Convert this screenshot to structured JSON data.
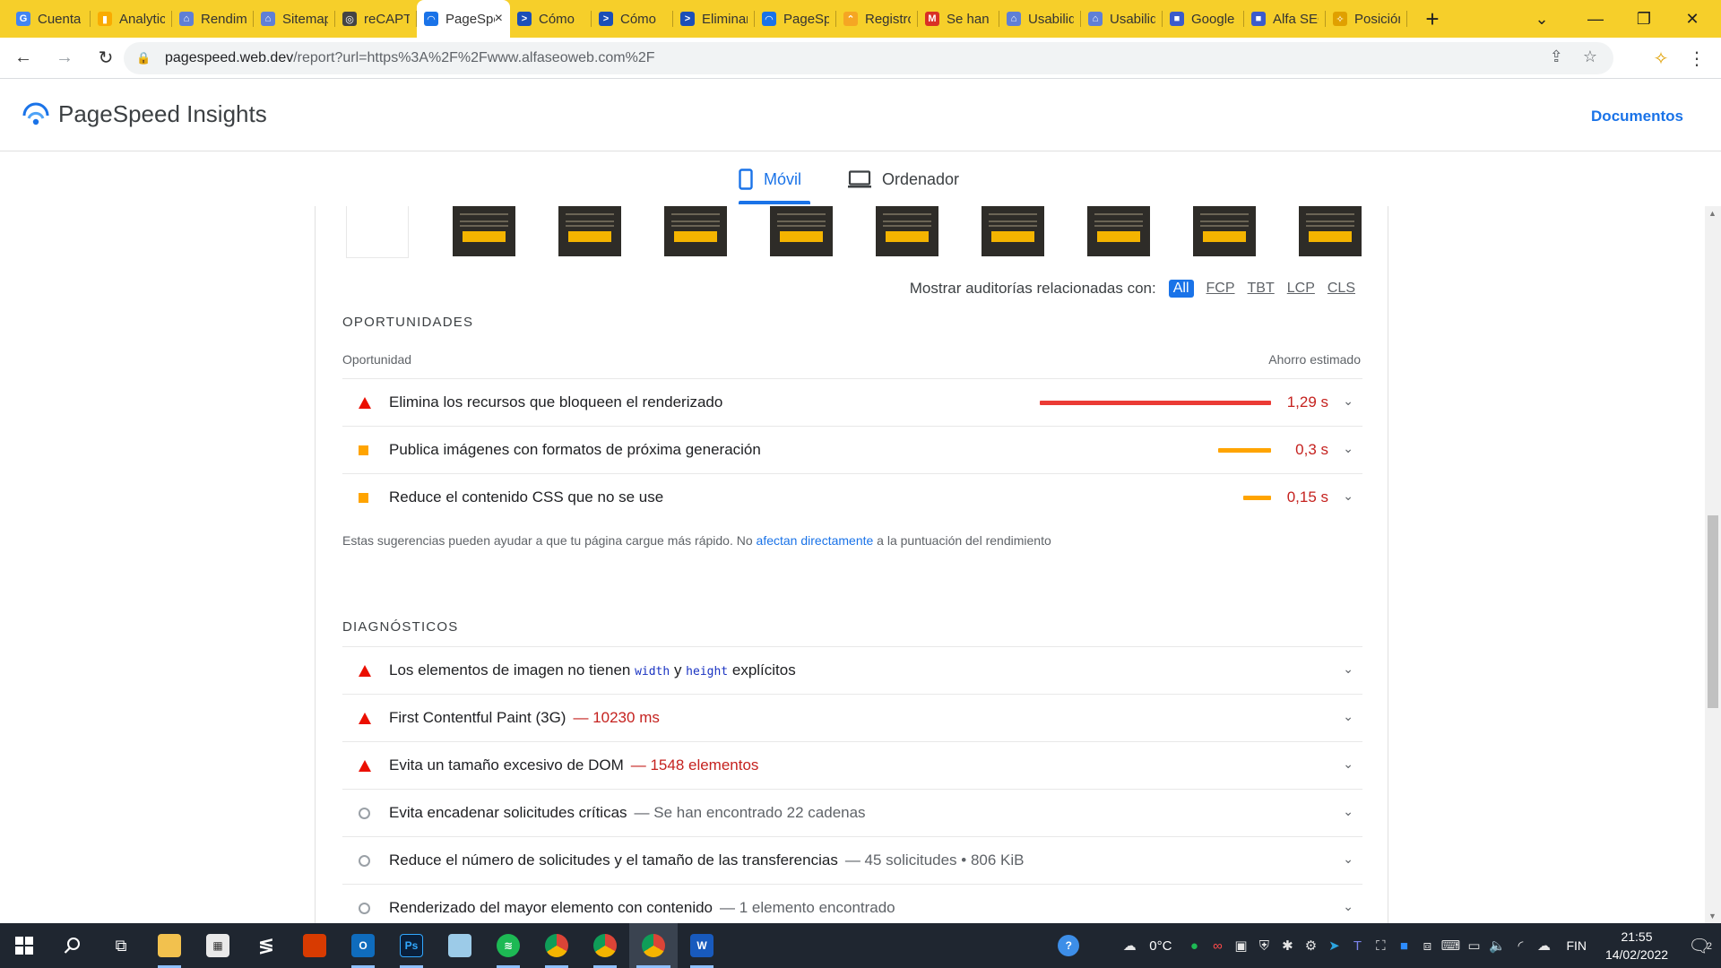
{
  "browser": {
    "tabs": [
      {
        "label": "Cuenta",
        "fav": "G",
        "favColor": "#4285f4"
      },
      {
        "label": "Analytics",
        "fav": "▮",
        "favColor": "#f9ab00"
      },
      {
        "label": "Rendimiento",
        "fav": "⌂",
        "favColor": "#5f7fd6"
      },
      {
        "label": "Sitemaps",
        "fav": "⌂",
        "favColor": "#5f7fd6"
      },
      {
        "label": "reCAPTCHA",
        "fav": "◎",
        "favColor": "#444"
      },
      {
        "label": "PageSpeed",
        "fav": "◠",
        "favColor": "#1a73e8",
        "active": true
      },
      {
        "label": "Cómo",
        "fav": ">",
        "favColor": "#1b4fb8"
      },
      {
        "label": "Cómo",
        "fav": ">",
        "favColor": "#1b4fb8"
      },
      {
        "label": "Eliminar",
        "fav": ">",
        "favColor": "#1b4fb8"
      },
      {
        "label": "PageSpeed",
        "fav": "◠",
        "favColor": "#1a73e8"
      },
      {
        "label": "Registro",
        "fav": "⌃",
        "favColor": "#f5a623"
      },
      {
        "label": "Se han",
        "fav": "M",
        "favColor": "#d93025"
      },
      {
        "label": "Usabilidad",
        "fav": "⌂",
        "favColor": "#5f7fd6"
      },
      {
        "label": "Usabilidad",
        "fav": "⌂",
        "favColor": "#5f7fd6"
      },
      {
        "label": "Google",
        "fav": "■",
        "favColor": "#3b5bcc"
      },
      {
        "label": "Alfa SEO",
        "fav": "■",
        "favColor": "#3b5bcc"
      },
      {
        "label": "Posición",
        "fav": "✧",
        "favColor": "#e0a000"
      }
    ],
    "new_tab": "+",
    "close_tab": "×",
    "url_host": "pagespeed.web.dev",
    "url_rest": "/report?url=https%3A%2F%2Fwww.alfaseoweb.com%2F"
  },
  "header": {
    "title": "PageSpeed Insights",
    "docs": "Documentos"
  },
  "device_tabs": {
    "mobile": "Móvil",
    "desktop": "Ordenador"
  },
  "related": {
    "label": "Mostrar auditorías relacionadas con:",
    "filters": [
      "All",
      "FCP",
      "TBT",
      "LCP",
      "CLS"
    ]
  },
  "opportunities": {
    "title": "OPORTUNIDADES",
    "col_left": "Oportunidad",
    "col_right": "Ahorro estimado",
    "items": [
      {
        "severity": "fail",
        "title": "Elimina los recursos que bloqueen el renderizado",
        "saving": "1,29 s",
        "bar_fraction": 1.0,
        "bar_color": "#eb3b35"
      },
      {
        "severity": "average",
        "title": "Publica imágenes con formatos de próxima generación",
        "saving": "0,3 s",
        "bar_fraction": 0.23,
        "bar_color": "#ffa400"
      },
      {
        "severity": "average",
        "title": "Reduce el contenido CSS que no se use",
        "saving": "0,15 s",
        "bar_fraction": 0.12,
        "bar_color": "#ffa400"
      }
    ],
    "note_pre": "Estas sugerencias pueden ayudar a que tu página cargue más rápido. No ",
    "note_link": "afectan directamente",
    "note_post": " a la puntuación del rendimiento"
  },
  "diagnostics": {
    "title": "DIAGNÓSTICOS",
    "item0": {
      "a": "Los elementos de imagen no tienen ",
      "code1": "width",
      "b": " y ",
      "code2": "height",
      "c": " explícitos"
    },
    "items": [
      {
        "severity": "fail",
        "title": "First Contentful Paint (3G)",
        "detail": "— 10230 ms",
        "detail_style": "red"
      },
      {
        "severity": "fail",
        "title": "Evita un tamaño excesivo de DOM",
        "detail": "— 1548 elementos",
        "detail_style": "red"
      },
      {
        "severity": "info",
        "title": "Evita encadenar solicitudes críticas",
        "detail": "— Se han encontrado 22 cadenas",
        "detail_style": "grey"
      },
      {
        "severity": "info",
        "title": "Reduce el número de solicitudes y el tamaño de las transferencias",
        "detail": "— 45 solicitudes • 806 KiB",
        "detail_style": "grey"
      },
      {
        "severity": "info",
        "title": "Renderizado del mayor elemento con contenido",
        "detail": "— 1 elemento encontrado",
        "detail_style": "grey"
      }
    ]
  },
  "taskbar": {
    "temperature": "0°C",
    "language": "FIN",
    "time": "21:55",
    "date": "14/02/2022",
    "notifications": "2"
  },
  "colors": {
    "accent": "#1a73e8",
    "fail": "#eb0f00",
    "average": "#ffa400",
    "tabstrip": "#f6cf2a"
  }
}
